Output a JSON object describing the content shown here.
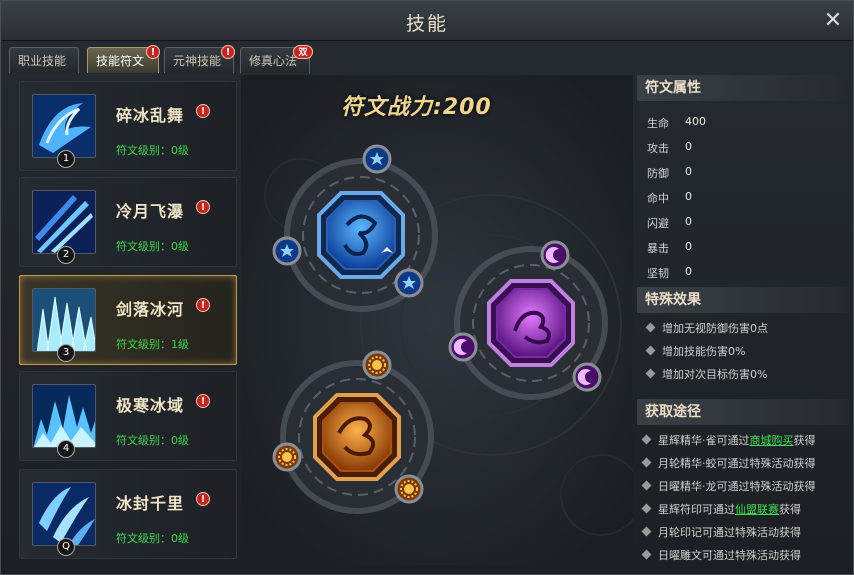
{
  "window": {
    "title": "技能",
    "close_icon": "close-icon"
  },
  "tabs": [
    {
      "label": "职业技能",
      "active": false,
      "badge": ""
    },
    {
      "label": "技能符文",
      "active": true,
      "badge": "!"
    },
    {
      "label": "元神技能",
      "active": false,
      "badge": "!"
    },
    {
      "label": "修真心法",
      "active": false,
      "badge": "双"
    }
  ],
  "skills": [
    {
      "name": "碎冰乱舞",
      "level": "符文级别：0级",
      "key": "1",
      "alert": "!",
      "icon": "ice-wave-icon"
    },
    {
      "name": "冷月飞瀑",
      "level": "符文级别：0级",
      "key": "2",
      "alert": "!",
      "icon": "ice-spears-icon"
    },
    {
      "name": "剑落冰河",
      "level": "符文级别：1级",
      "key": "3",
      "alert": "!",
      "icon": "ice-crystal-icon"
    },
    {
      "name": "极寒冰域",
      "level": "符文级别：0级",
      "key": "4",
      "alert": "!",
      "icon": "ice-field-icon"
    },
    {
      "name": "冰封千里",
      "level": "符文级别：0级",
      "key": "Q",
      "alert": "!",
      "icon": "ice-blades-icon"
    }
  ],
  "rune_power": {
    "label": "符文战力:",
    "value": "200"
  },
  "runes": [
    {
      "name": "rune-slot-blue",
      "icon": "serpent-emblem-icon",
      "color": "#2e7ad6",
      "sub_icon": "star-icon"
    },
    {
      "name": "rune-slot-purple",
      "icon": "dragon-emblem-icon",
      "color": "#a030c8",
      "sub_icon": "moon-icon"
    },
    {
      "name": "rune-slot-orange",
      "icon": "dragon-emblem-icon",
      "color": "#e07a14",
      "sub_icon": "sun-icon"
    }
  ],
  "attributes": {
    "title": "符文属性",
    "rows": [
      {
        "label": "生命",
        "value": "400"
      },
      {
        "label": "攻击",
        "value": "0"
      },
      {
        "label": "防御",
        "value": "0"
      },
      {
        "label": "命中",
        "value": "0"
      },
      {
        "label": "闪避",
        "value": "0"
      },
      {
        "label": "暴击",
        "value": "0"
      },
      {
        "label": "坚韧",
        "value": "0"
      }
    ]
  },
  "effects": {
    "title": "特殊效果",
    "rows": [
      "增加无视防御伤害0点",
      "增加技能伤害0%",
      "增加对次目标伤害0%"
    ]
  },
  "sources": {
    "title": "获取途径",
    "rows": [
      {
        "pre": "星辉精华·雀可通过",
        "link": "商城购买",
        "post": "获得"
      },
      {
        "pre": "月轮精华·蛟可通过特殊活动获得",
        "link": "",
        "post": ""
      },
      {
        "pre": "日曜精华·龙可通过特殊活动获得",
        "link": "",
        "post": ""
      },
      {
        "pre": "星辉符印可通过",
        "link": "仙盟联赛",
        "post": "获得"
      },
      {
        "pre": "月轮印记可通过特殊活动获得",
        "link": "",
        "post": ""
      },
      {
        "pre": "日曜雕文可通过特殊活动获得",
        "link": "",
        "post": ""
      }
    ]
  },
  "colors": {
    "accent": "#c29a47",
    "level_green": "#3cd54a",
    "link_green": "#3be04a",
    "alert_red": "#c8231f"
  }
}
